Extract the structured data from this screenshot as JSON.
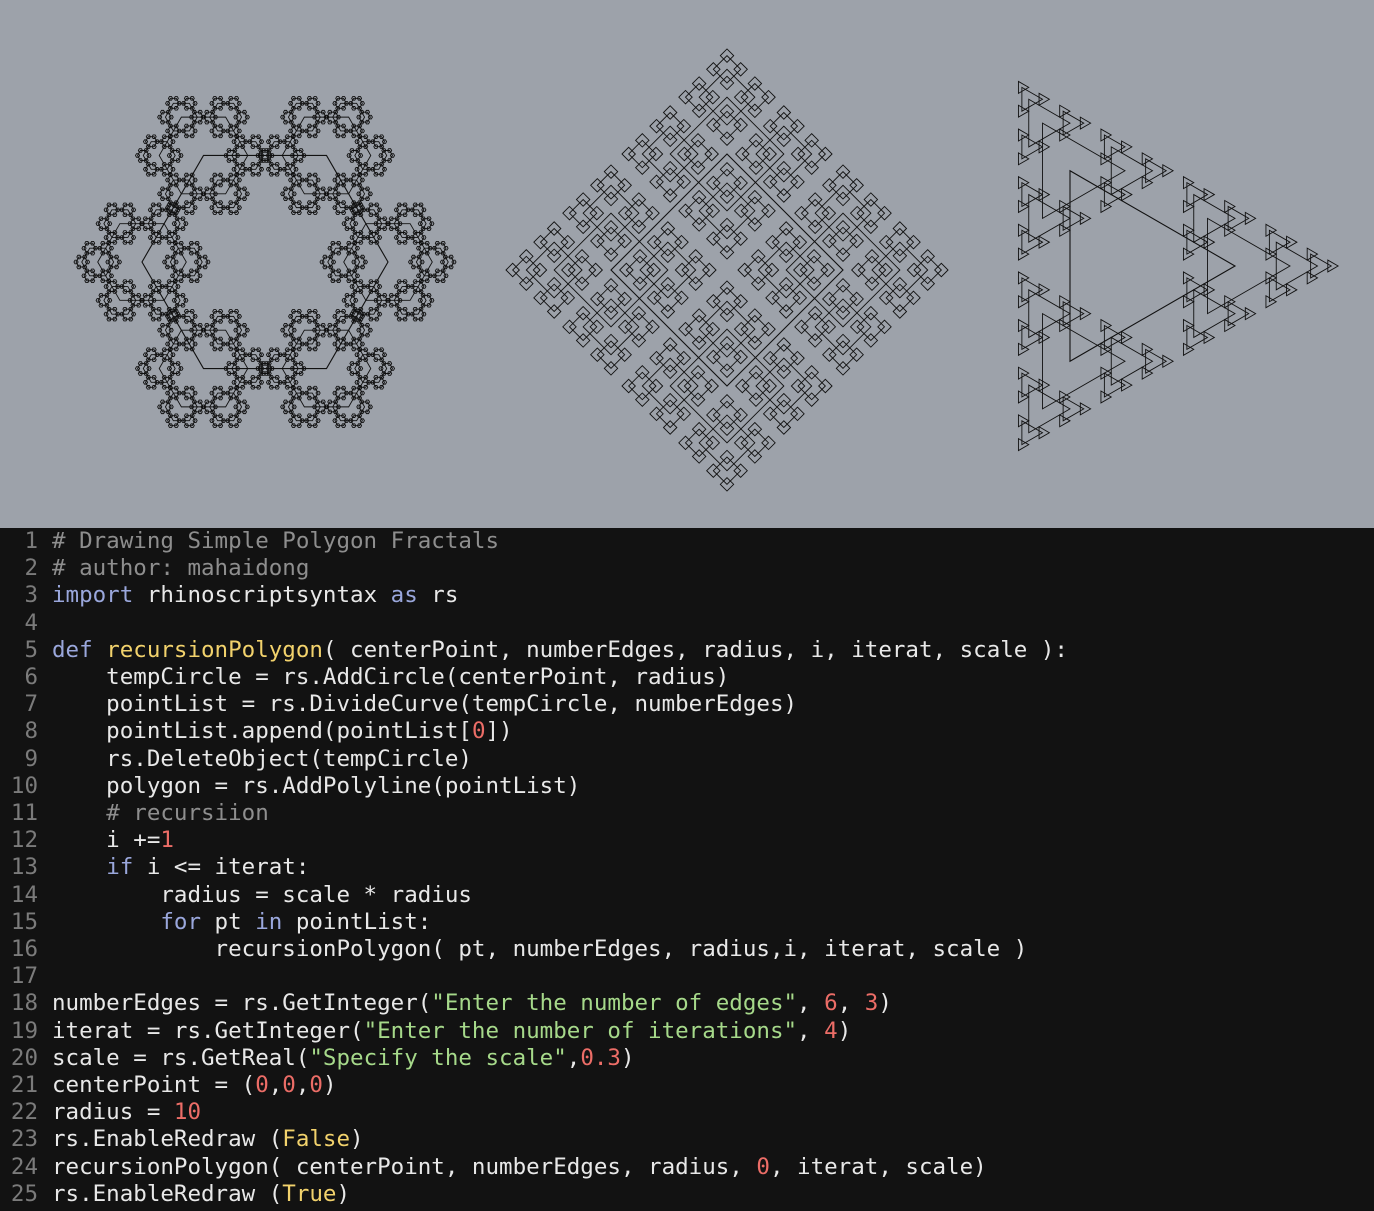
{
  "viewport": {
    "background": "#9da2aa",
    "stroke": "#111111",
    "fractals": [
      {
        "name": "hexagon-fractal",
        "edges": 6,
        "iterations": 4,
        "scale": 0.3
      },
      {
        "name": "square-fractal",
        "edges": 4,
        "iterations": 4,
        "scale": 0.3
      },
      {
        "name": "triangle-fractal",
        "edges": 3,
        "iterations": 4,
        "scale": 0.3
      }
    ]
  },
  "editor": {
    "background": "#121212",
    "lines": [
      {
        "n": "1",
        "tokens": [
          {
            "t": "comment",
            "v": "# Drawing Simple Polygon Fractals"
          }
        ]
      },
      {
        "n": "2",
        "tokens": [
          {
            "t": "comment",
            "v": "# author: mahaidong"
          }
        ]
      },
      {
        "n": "3",
        "tokens": [
          {
            "t": "keyword",
            "v": "import"
          },
          {
            "t": "plain",
            "v": " rhinoscriptsyntax "
          },
          {
            "t": "keyword",
            "v": "as"
          },
          {
            "t": "plain",
            "v": " rs"
          }
        ]
      },
      {
        "n": "4",
        "tokens": []
      },
      {
        "n": "5",
        "tokens": [
          {
            "t": "keyword",
            "v": "def"
          },
          {
            "t": "plain",
            "v": " "
          },
          {
            "t": "func",
            "v": "recursionPolygon"
          },
          {
            "t": "plain",
            "v": "( centerPoint, numberEdges, radius, i, iterat, scale ):"
          }
        ]
      },
      {
        "n": "6",
        "tokens": [
          {
            "t": "plain",
            "v": "    tempCircle = rs.AddCircle(centerPoint, radius)"
          }
        ]
      },
      {
        "n": "7",
        "tokens": [
          {
            "t": "plain",
            "v": "    pointList = rs.DivideCurve(tempCircle, numberEdges)"
          }
        ]
      },
      {
        "n": "8",
        "tokens": [
          {
            "t": "plain",
            "v": "    pointList.append(pointList["
          },
          {
            "t": "number",
            "v": "0"
          },
          {
            "t": "plain",
            "v": "])"
          }
        ]
      },
      {
        "n": "9",
        "tokens": [
          {
            "t": "plain",
            "v": "    rs.DeleteObject(tempCircle)"
          }
        ]
      },
      {
        "n": "10",
        "tokens": [
          {
            "t": "plain",
            "v": "    polygon = rs.AddPolyline(pointList)"
          }
        ]
      },
      {
        "n": "11",
        "tokens": [
          {
            "t": "plain",
            "v": "    "
          },
          {
            "t": "comment",
            "v": "# recursiion"
          }
        ]
      },
      {
        "n": "12",
        "tokens": [
          {
            "t": "plain",
            "v": "    i +="
          },
          {
            "t": "number",
            "v": "1"
          }
        ]
      },
      {
        "n": "13",
        "tokens": [
          {
            "t": "plain",
            "v": "    "
          },
          {
            "t": "keyword",
            "v": "if"
          },
          {
            "t": "plain",
            "v": " i <= iterat:"
          }
        ]
      },
      {
        "n": "14",
        "tokens": [
          {
            "t": "plain",
            "v": "        radius = scale * radius"
          }
        ]
      },
      {
        "n": "15",
        "tokens": [
          {
            "t": "plain",
            "v": "        "
          },
          {
            "t": "keyword",
            "v": "for"
          },
          {
            "t": "plain",
            "v": " pt "
          },
          {
            "t": "keyword",
            "v": "in"
          },
          {
            "t": "plain",
            "v": " pointList:"
          }
        ]
      },
      {
        "n": "16",
        "tokens": [
          {
            "t": "plain",
            "v": "            recursionPolygon( pt, numberEdges, radius,i, iterat, scale )"
          }
        ]
      },
      {
        "n": "17",
        "tokens": []
      },
      {
        "n": "18",
        "tokens": [
          {
            "t": "plain",
            "v": "numberEdges = rs.GetInteger("
          },
          {
            "t": "string",
            "v": "\"Enter the number of edges\""
          },
          {
            "t": "plain",
            "v": ", "
          },
          {
            "t": "number",
            "v": "6"
          },
          {
            "t": "plain",
            "v": ", "
          },
          {
            "t": "number",
            "v": "3"
          },
          {
            "t": "plain",
            "v": ")"
          }
        ]
      },
      {
        "n": "19",
        "tokens": [
          {
            "t": "plain",
            "v": "iterat = rs.GetInteger("
          },
          {
            "t": "string",
            "v": "\"Enter the number of iterations\""
          },
          {
            "t": "plain",
            "v": ", "
          },
          {
            "t": "number",
            "v": "4"
          },
          {
            "t": "plain",
            "v": ")"
          }
        ]
      },
      {
        "n": "20",
        "tokens": [
          {
            "t": "plain",
            "v": "scale = rs.GetReal("
          },
          {
            "t": "string",
            "v": "\"Specify the scale\""
          },
          {
            "t": "plain",
            "v": ","
          },
          {
            "t": "number",
            "v": "0.3"
          },
          {
            "t": "plain",
            "v": ")"
          }
        ]
      },
      {
        "n": "21",
        "tokens": [
          {
            "t": "plain",
            "v": "centerPoint = ("
          },
          {
            "t": "number",
            "v": "0"
          },
          {
            "t": "plain",
            "v": ","
          },
          {
            "t": "number",
            "v": "0"
          },
          {
            "t": "plain",
            "v": ","
          },
          {
            "t": "number",
            "v": "0"
          },
          {
            "t": "plain",
            "v": ")"
          }
        ]
      },
      {
        "n": "22",
        "tokens": [
          {
            "t": "plain",
            "v": "radius = "
          },
          {
            "t": "number",
            "v": "10"
          }
        ]
      },
      {
        "n": "23",
        "tokens": [
          {
            "t": "plain",
            "v": "rs.EnableRedraw ("
          },
          {
            "t": "const",
            "v": "False"
          },
          {
            "t": "plain",
            "v": ")"
          }
        ]
      },
      {
        "n": "24",
        "tokens": [
          {
            "t": "plain",
            "v": "recursionPolygon( centerPoint, numberEdges, radius, "
          },
          {
            "t": "number",
            "v": "0"
          },
          {
            "t": "plain",
            "v": ", iterat, scale)"
          }
        ]
      },
      {
        "n": "25",
        "tokens": [
          {
            "t": "plain",
            "v": "rs.EnableRedraw ("
          },
          {
            "t": "const",
            "v": "True"
          },
          {
            "t": "plain",
            "v": ")"
          }
        ]
      }
    ]
  }
}
